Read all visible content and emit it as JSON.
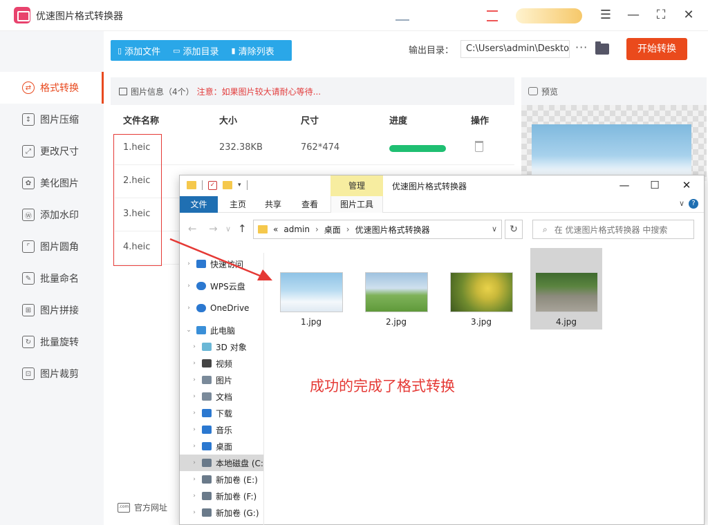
{
  "app": {
    "title": "优速图片格式转换器"
  },
  "sidebar": {
    "items": [
      {
        "label": "格式转换",
        "icon": "convert-icon",
        "active": true
      },
      {
        "label": "图片压缩",
        "icon": "compress-icon"
      },
      {
        "label": "更改尺寸",
        "icon": "resize-icon"
      },
      {
        "label": "美化图片",
        "icon": "beautify-icon"
      },
      {
        "label": "添加水印",
        "icon": "watermark-icon"
      },
      {
        "label": "图片圆角",
        "icon": "round-corner-icon"
      },
      {
        "label": "批量命名",
        "icon": "rename-icon"
      },
      {
        "label": "图片拼接",
        "icon": "stitch-icon"
      },
      {
        "label": "批量旋转",
        "icon": "rotate-icon"
      },
      {
        "label": "图片裁剪",
        "icon": "crop-icon"
      }
    ],
    "footer": "官方网址"
  },
  "toolbar": {
    "add_file": "添加文件",
    "add_dir": "添加目录",
    "clear_list": "清除列表",
    "output_label": "输出目录：",
    "output_path": "C:\\Users\\admin\\Deskto",
    "more": "···",
    "start": "开始转换"
  },
  "file_table": {
    "info": "图片信息（4个）",
    "warning": "注意：如果图片较大请耐心等待...",
    "columns": [
      "文件名称",
      "大小",
      "尺寸",
      "进度",
      "操作"
    ],
    "rows": [
      {
        "name": "1.heic",
        "size": "232.38KB",
        "dims": "762*474",
        "progress": 1.0
      },
      {
        "name": "2.heic"
      },
      {
        "name": "3.heic"
      },
      {
        "name": "4.heic"
      }
    ]
  },
  "preview": {
    "label": "预览"
  },
  "explorer": {
    "manage_tab": "管理",
    "title": "优速图片格式转换器",
    "ribbon_tabs": [
      "文件",
      "主页",
      "共享",
      "查看",
      "图片工具"
    ],
    "address": {
      "prefix": "«",
      "parts": [
        "admin",
        "桌面",
        "优速图片格式转换器"
      ]
    },
    "search_placeholder": "在 优速图片格式转换器 中搜索",
    "nav_items": [
      {
        "label": "快速访问",
        "color": "#2b78d0"
      },
      {
        "label": "WPS云盘",
        "color": "#2b78d0"
      },
      {
        "label": "OneDrive",
        "color": "#2b78d0"
      },
      {
        "label": "此电脑",
        "color": "#3a8fd8"
      },
      {
        "label": "3D 对象",
        "color": "#6ab7d6"
      },
      {
        "label": "视频",
        "color": "#444"
      },
      {
        "label": "图片",
        "color": "#7a8a9a"
      },
      {
        "label": "文档",
        "color": "#7a8a9a"
      },
      {
        "label": "下载",
        "color": "#2b78d0"
      },
      {
        "label": "音乐",
        "color": "#2b78d0"
      },
      {
        "label": "桌面",
        "color": "#2b78d0"
      },
      {
        "label": "本地磁盘 (C:",
        "color": "#6a7a8a"
      },
      {
        "label": "新加卷 (E:)",
        "color": "#6a7a8a"
      },
      {
        "label": "新加卷 (F:)",
        "color": "#6a7a8a"
      },
      {
        "label": "新加卷 (G:)",
        "color": "#6a7a8a"
      }
    ],
    "files": [
      {
        "name": "1.jpg"
      },
      {
        "name": "2.jpg"
      },
      {
        "name": "3.jpg"
      },
      {
        "name": "4.jpg",
        "selected": true
      }
    ]
  },
  "annotation": {
    "success": "成功的完成了格式转换"
  },
  "colors": {
    "accent": "#e84a1f",
    "toolbar_blue": "#2aa7e8",
    "start_button": "#ea4a1c",
    "progress_green": "#1fbf72",
    "annotation_red": "#e53935"
  }
}
